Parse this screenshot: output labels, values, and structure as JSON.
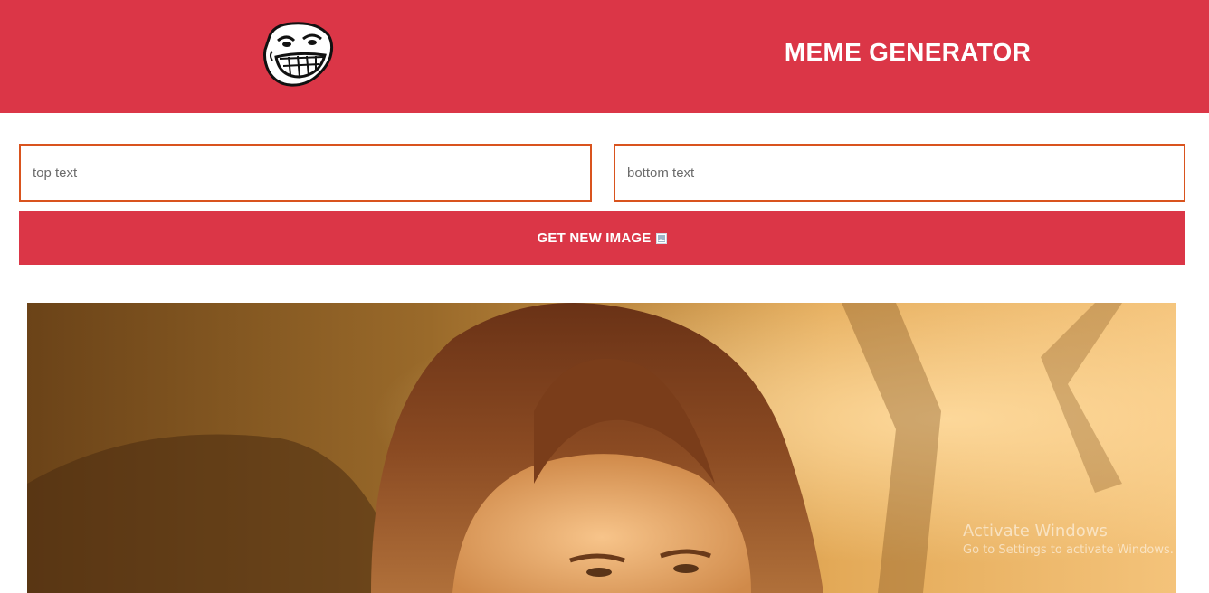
{
  "header": {
    "title": "MEME GENERATOR",
    "logo_icon": "troll-face-icon",
    "background": "#db3647"
  },
  "form": {
    "top_text": {
      "value": "",
      "placeholder": "top text"
    },
    "bottom_text": {
      "value": "",
      "placeholder": "bottom text"
    },
    "border_color": "#d9531e",
    "button_label": "GET NEW IMAGE",
    "button_icon": "image-icon"
  },
  "meme": {
    "image_icon": "meme-photo"
  },
  "watermark": {
    "line1": "Activate Windows",
    "line2": "Go to Settings to activate Windows."
  }
}
